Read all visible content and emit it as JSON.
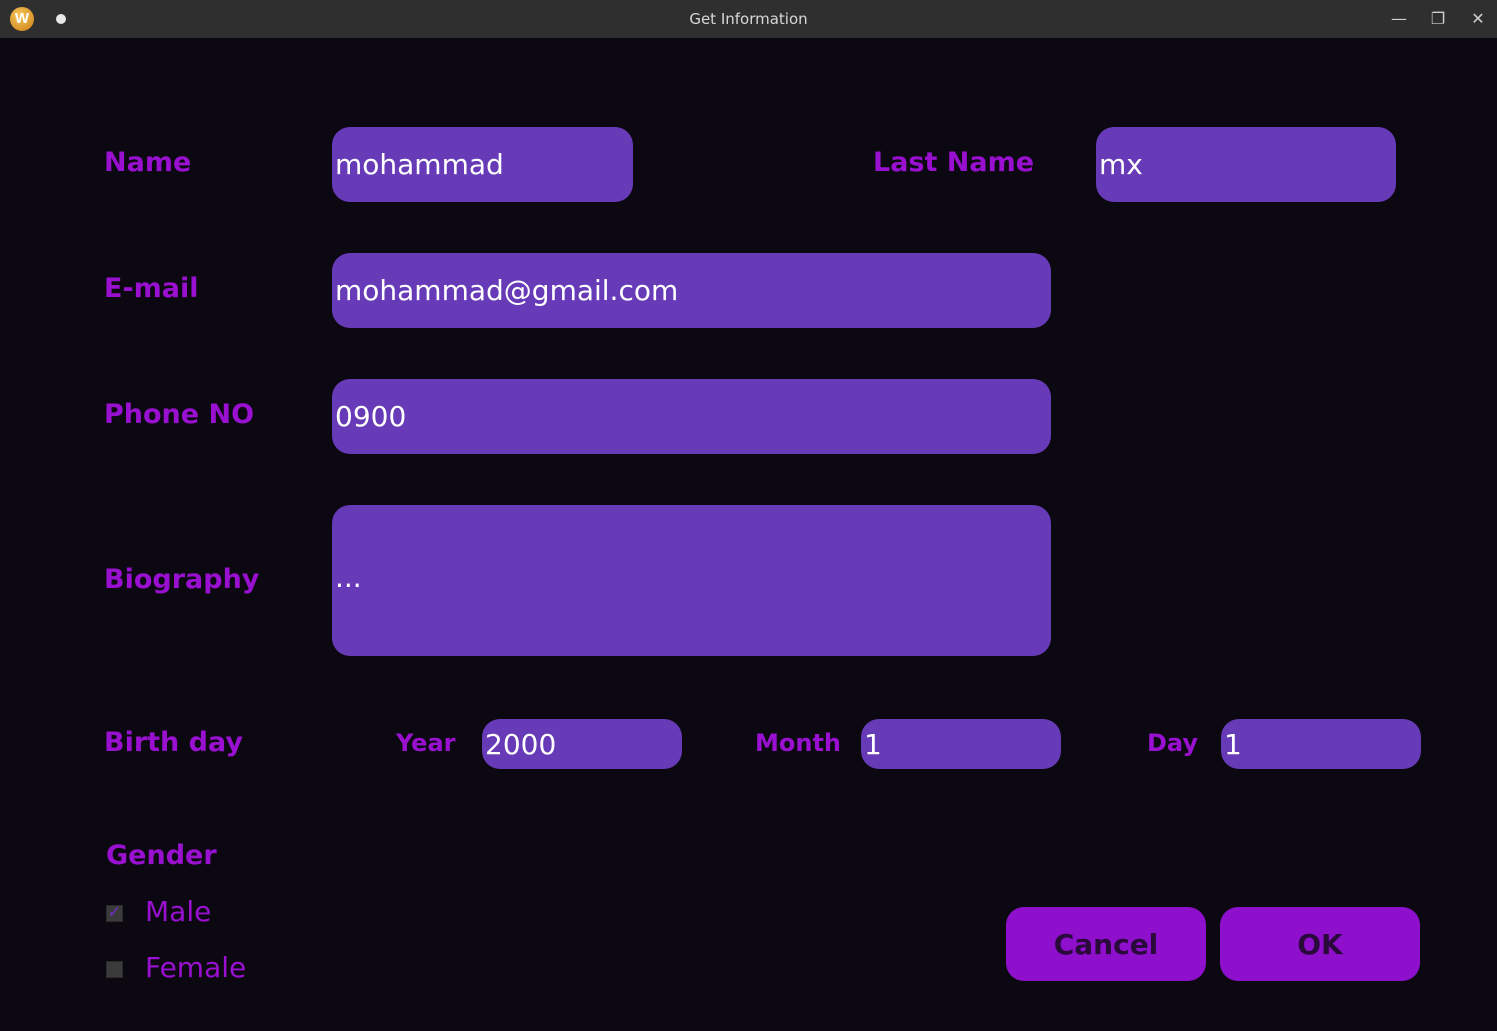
{
  "window": {
    "title": "Get Information",
    "app_icon_letter": "W",
    "minimize_glyph": "—",
    "restore_glyph": "❐",
    "close_glyph": "✕"
  },
  "form": {
    "name": {
      "label": "Name",
      "value": "mohammad"
    },
    "last_name": {
      "label": "Last Name",
      "value": "mx"
    },
    "email": {
      "label": "E-mail",
      "value": "mohammad@gmail.com"
    },
    "phone": {
      "label": "Phone NO",
      "value": "0900"
    },
    "biography": {
      "label": "Biography",
      "value": "..."
    },
    "birthday": {
      "label": "Birth day",
      "year": {
        "label": "Year",
        "value": "2000"
      },
      "month": {
        "label": "Month",
        "value": "1"
      },
      "day": {
        "label": "Day",
        "value": "1"
      }
    },
    "gender": {
      "label": "Gender",
      "options": [
        {
          "label": "Male",
          "checked": true
        },
        {
          "label": "Female",
          "checked": false
        }
      ]
    }
  },
  "buttons": {
    "cancel": "Cancel",
    "ok": "OK"
  },
  "colors": {
    "background": "#0b0812",
    "label": "#9a10d0",
    "field": "#673ab7",
    "button": "#8e0fcc"
  }
}
